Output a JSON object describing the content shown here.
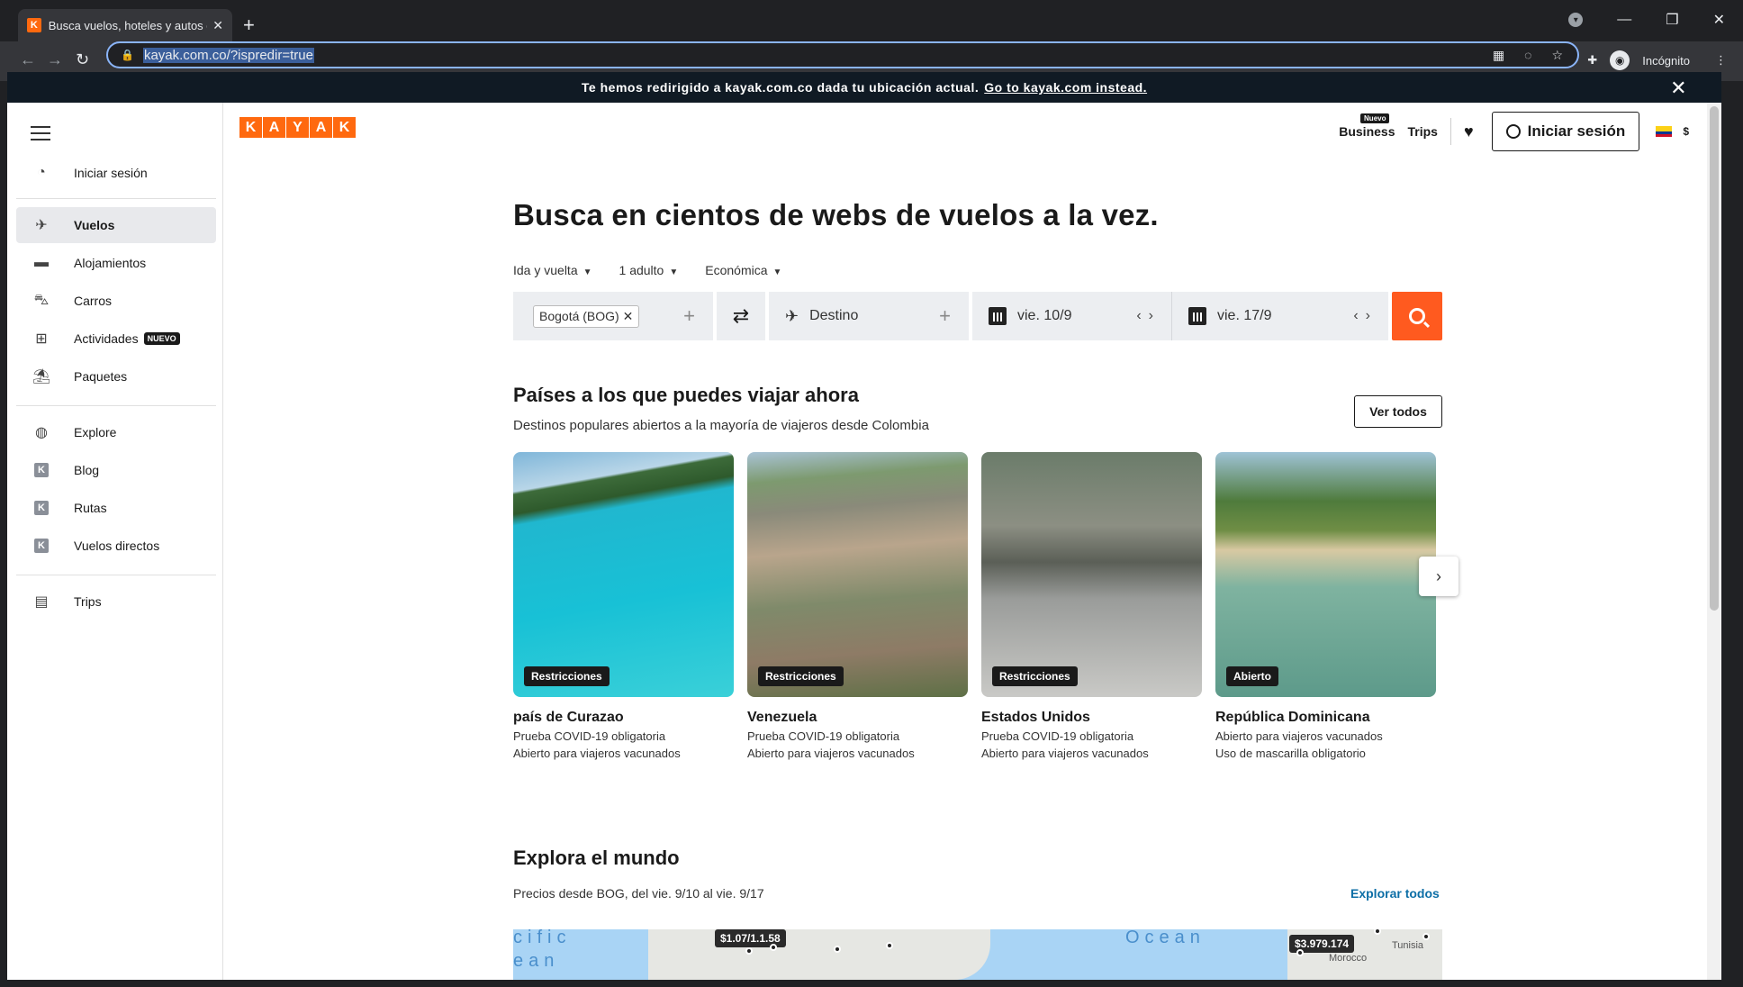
{
  "browser": {
    "tab_title": "Busca vuelos, hoteles y autos de",
    "tab_favicon": "K",
    "url": "kayak.com.co/?ispredir=true",
    "profile": "Incógnito"
  },
  "redirect": {
    "text": "Te hemos redirigido a kayak.com.co dada tu ubicación actual.",
    "link": "Go to kayak.com instead."
  },
  "sidebar": {
    "signin": "Iniciar sesión",
    "items": [
      "Vuelos",
      "Alojamientos",
      "Carros",
      "Actividades",
      "Paquetes"
    ],
    "activities_badge": "NUEVO",
    "explore_items": [
      "Explore",
      "Blog",
      "Rutas",
      "Vuelos directos"
    ],
    "trips": "Trips"
  },
  "header": {
    "logo": [
      "K",
      "A",
      "Y",
      "A",
      "K"
    ],
    "business": "Business",
    "business_badge": "Nuevo",
    "trips": "Trips",
    "signin": "Iniciar sesión",
    "currency": "$"
  },
  "search": {
    "headline": "Busca en cientos de webs de vuelos a la vez.",
    "trip_type": "Ida y vuelta",
    "travelers": "1 adulto",
    "cabin": "Económica",
    "origin": "Bogotá (BOG)",
    "destination_placeholder": "Destino",
    "depart": "vie. 10/9",
    "return": "vie. 17/9"
  },
  "countries": {
    "title": "Países a los que puedes viajar ahora",
    "subtitle": "Destinos populares abiertos a la mayoría de viajeros desde Colombia",
    "view_all": "Ver todos",
    "cards": [
      {
        "badge": "Restricciones",
        "name": "país de Curazao",
        "line1": "Prueba COVID-19 obligatoria",
        "line2": "Abierto para viajeros vacunados"
      },
      {
        "badge": "Restricciones",
        "name": "Venezuela",
        "line1": "Prueba COVID-19 obligatoria",
        "line2": "Abierto para viajeros vacunados"
      },
      {
        "badge": "Restricciones",
        "name": "Estados Unidos",
        "line1": "Prueba COVID-19 obligatoria",
        "line2": "Abierto para viajeros vacunados"
      },
      {
        "badge": "Abierto",
        "name": "República Dominicana",
        "line1": "Abierto para viajeros vacunados",
        "line2": "Uso de mascarilla obligatorio"
      }
    ]
  },
  "explore": {
    "title": "Explora el mundo",
    "subtitle": "Precios desde BOG, del vie. 9/10 al vie. 9/17",
    "link": "Explorar todos",
    "ocean_left": "cific",
    "ocean_left2": "ean",
    "ocean_right": "Ocean",
    "price1": "$1.07/1.1.58",
    "price2": "$3.979.174",
    "place_label": "Tunisia",
    "place_label2": "Morocco"
  }
}
